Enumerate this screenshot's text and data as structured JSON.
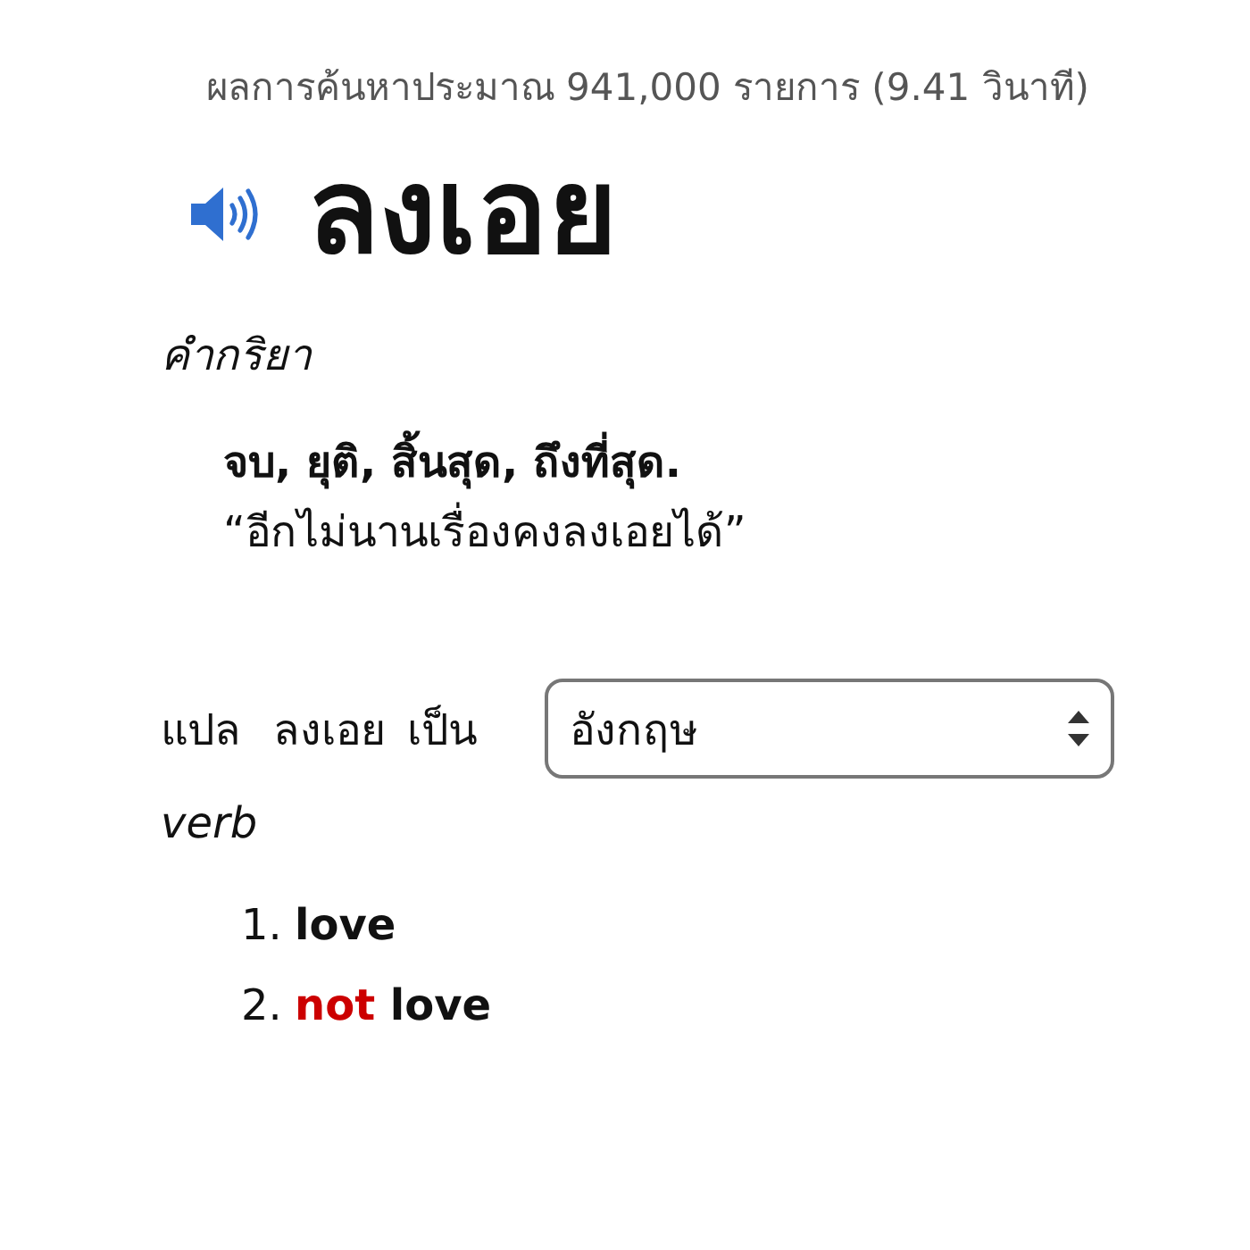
{
  "result_stats": "ผลการค้นหาประมาณ 941,000 รายการ (9.41 วินาที)",
  "entry": {
    "headword": "ลงเอย",
    "part_of_speech": "คำกริยา",
    "definition": "จบ, ยุติ, สิ้นสุด, ถึงที่สุด.",
    "example": "“อีกไม่นานเรื่องคงลงเอยได้”"
  },
  "translate": {
    "label": "แปล",
    "word": "ลงเอย",
    "to_label": "เป็น",
    "language_select": {
      "value": "อังกฤษ"
    }
  },
  "translation": {
    "part_of_speech": "verb",
    "senses": [
      {
        "number": "1.",
        "parts": [
          {
            "text": "love",
            "kind": "word"
          }
        ]
      },
      {
        "number": "2.",
        "parts": [
          {
            "text": "not",
            "kind": "negation"
          },
          {
            "text": "love",
            "kind": "word"
          }
        ]
      }
    ]
  }
}
